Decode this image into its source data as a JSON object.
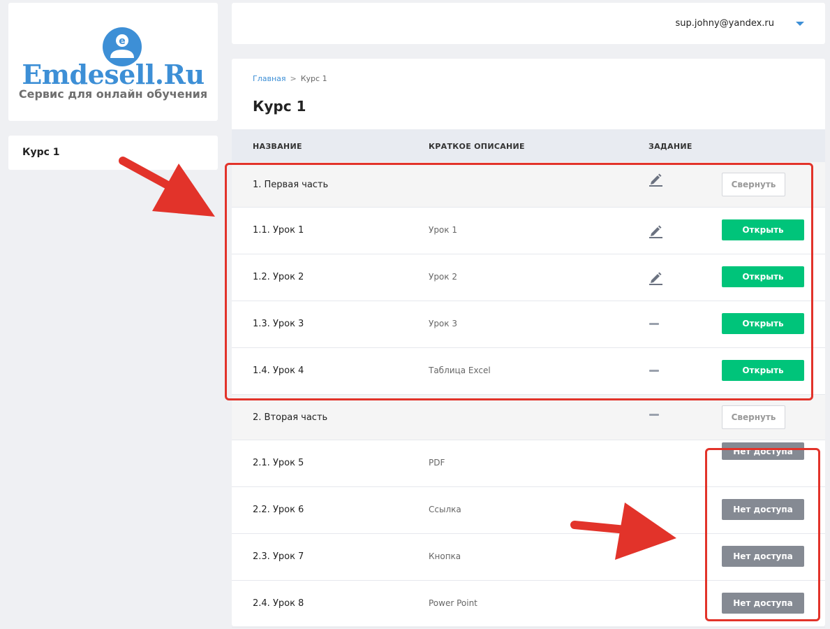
{
  "logo": {
    "title": "Emdesell.Ru",
    "subtitle": "Сервис для онлайн обучения",
    "icon": "person-e-icon",
    "color": "#3d8fd6"
  },
  "sidebar": {
    "items": [
      {
        "label": "Курс 1"
      }
    ]
  },
  "header": {
    "user_email": "sup.johny@yandex.ru"
  },
  "breadcrumb": {
    "home": "Главная",
    "separator": ">",
    "current": "Курс 1"
  },
  "page": {
    "title": "Курс 1"
  },
  "table": {
    "columns": {
      "name": "НАЗВАНИЕ",
      "desc": "КРАТКОЕ ОПИСАНИЕ",
      "task": "ЗАДАНИЕ"
    },
    "rows": [
      {
        "name": "1. Первая часть",
        "desc": "",
        "task": "pencil-icon",
        "button": "Свернуть",
        "kind": "section"
      },
      {
        "name": "1.1. Урок 1",
        "desc": "Урок 1",
        "task": "pencil-icon",
        "button": "Открыть",
        "kind": "open"
      },
      {
        "name": "1.2. Урок 2",
        "desc": "Урок 2",
        "task": "pencil-icon",
        "button": "Открыть",
        "kind": "open"
      },
      {
        "name": "1.3. Урок 3",
        "desc": "Урок 3",
        "task": "dash-icon",
        "button": "Открыть",
        "kind": "open"
      },
      {
        "name": "1.4. Урок 4",
        "desc": "Таблица Excel",
        "task": "dash-icon",
        "button": "Открыть",
        "kind": "open"
      },
      {
        "name": "2. Вторая часть",
        "desc": "",
        "task": "dash-icon",
        "button": "Свернуть",
        "kind": "section"
      },
      {
        "name": "2.1. Урок 5",
        "desc": "PDF",
        "task": "",
        "button": "Нет доступа",
        "kind": "noaccess"
      },
      {
        "name": "2.2. Урок 6",
        "desc": "Ссылка",
        "task": "",
        "button": "Нет доступа",
        "kind": "noaccess"
      },
      {
        "name": "2.3. Урок 7",
        "desc": "Кнопка",
        "task": "",
        "button": "Нет доступа",
        "kind": "noaccess"
      },
      {
        "name": "2.4. Урок 8",
        "desc": "Power Point",
        "task": "",
        "button": "Нет доступа",
        "kind": "noaccess"
      }
    ]
  },
  "colors": {
    "open": "#00c47a",
    "noaccess": "#858a93",
    "annotation": "#e2332a",
    "accent": "#3d8fd6"
  }
}
